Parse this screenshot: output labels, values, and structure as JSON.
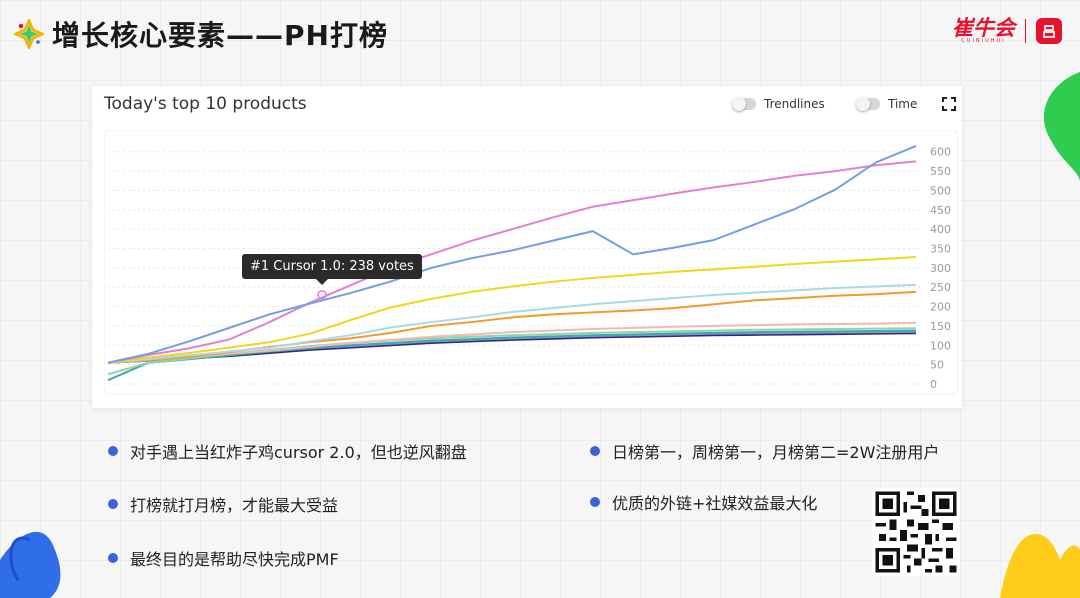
{
  "page": {
    "title": "增长核心要素——PH打榜",
    "brand": {
      "name": "崔牛会",
      "sub": "CUINIUHUI"
    }
  },
  "card": {
    "title": "Today's top 10 products",
    "toggles": [
      {
        "label": "Trendlines"
      },
      {
        "label": "Time"
      }
    ],
    "tooltip": "#1 Cursor 1.0: 238 votes"
  },
  "bullets": [
    {
      "text": "对手遇上当红炸子鸡cursor 2.0，但也逆风翻盘"
    },
    {
      "text": " 打榜就打月榜，才能最大受益"
    },
    {
      "text": "最终目的是帮助尽快完成PMF"
    },
    {
      "text": "日榜第一，周榜第一，月榜第二=2W注册用户"
    },
    {
      "text": "优质的外链+社媒效益最大化"
    }
  ],
  "chart_data": {
    "type": "line",
    "title": "",
    "xlabel": "",
    "ylabel": "",
    "ylim": [
      0,
      620
    ],
    "y_ticks": [
      0,
      50,
      100,
      150,
      200,
      250,
      300,
      350,
      400,
      450,
      500,
      550,
      600
    ],
    "grid": true,
    "y_axis_side": "right",
    "x": [
      0,
      1,
      2,
      3,
      4,
      5,
      6,
      7,
      8,
      9,
      10,
      11,
      12,
      13,
      14,
      15,
      16,
      17,
      18,
      19,
      20
    ],
    "series": [
      {
        "color": "#6fa0e3",
        "values": [
          55,
          78,
          110,
          145,
          180,
          208,
          235,
          265,
          300,
          325,
          345,
          370,
          395,
          335,
          352,
          372,
          412,
          452,
          502,
          572,
          615
        ]
      },
      {
        "color": "#e37fd4",
        "values": [
          55,
          75,
          92,
          115,
          160,
          210,
          255,
          300,
          335,
          370,
          400,
          430,
          458,
          475,
          492,
          508,
          522,
          538,
          550,
          565,
          575
        ]
      },
      {
        "color": "#f3d51b",
        "values": [
          55,
          68,
          80,
          94,
          108,
          130,
          165,
          198,
          220,
          238,
          252,
          264,
          274,
          282,
          290,
          296,
          303,
          310,
          316,
          322,
          328
        ]
      },
      {
        "color": "#a8d9e6",
        "values": [
          55,
          64,
          74,
          84,
          94,
          110,
          126,
          146,
          160,
          172,
          186,
          196,
          206,
          214,
          222,
          230,
          236,
          242,
          248,
          252,
          256
        ]
      },
      {
        "color": "#f29a2e",
        "values": [
          55,
          62,
          70,
          82,
          96,
          108,
          118,
          132,
          150,
          160,
          172,
          180,
          185,
          190,
          196,
          206,
          216,
          222,
          228,
          232,
          238
        ]
      },
      {
        "color": "#f4b6b6",
        "values": [
          55,
          62,
          70,
          78,
          86,
          96,
          106,
          114,
          122,
          128,
          134,
          138,
          142,
          145,
          148,
          150,
          152,
          154,
          155,
          156,
          158
        ]
      },
      {
        "color": "#8fd3a8",
        "values": [
          25,
          55,
          66,
          78,
          88,
          98,
          106,
          112,
          118,
          122,
          126,
          129,
          132,
          134,
          136,
          138,
          140,
          141,
          142,
          143,
          144
        ]
      },
      {
        "color": "#3aaab0",
        "values": [
          10,
          55,
          64,
          74,
          84,
          92,
          100,
          106,
          112,
          116,
          120,
          123,
          126,
          128,
          130,
          132,
          134,
          135,
          136,
          137,
          138
        ]
      },
      {
        "color": "#9b8fd6",
        "values": [
          55,
          60,
          68,
          76,
          84,
          92,
          98,
          104,
          110,
          114,
          118,
          121,
          124,
          126,
          128,
          130,
          131,
          132,
          133,
          134,
          135
        ]
      },
      {
        "color": "#2e2a7a",
        "values": [
          55,
          60,
          66,
          72,
          80,
          88,
          94,
          100,
          106,
          110,
          114,
          117,
          120,
          122,
          124,
          126,
          127,
          128,
          129,
          130,
          131
        ]
      }
    ]
  }
}
